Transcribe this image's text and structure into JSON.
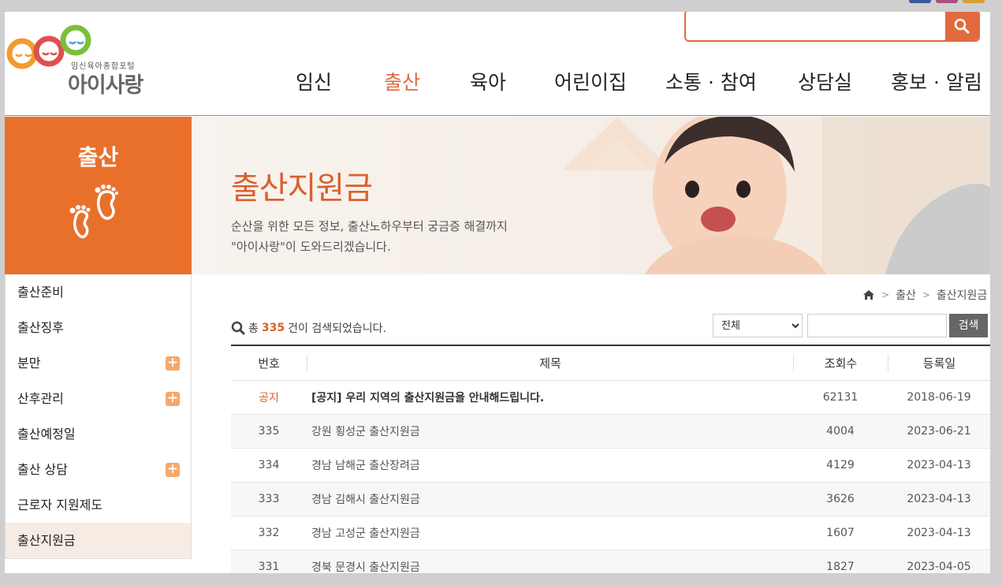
{
  "header": {
    "logo_sub": "임신육아종합포털",
    "logo_main": "아이사랑",
    "search_placeholder": "",
    "nav": [
      "임신",
      "출산",
      "육아",
      "어린이집",
      "소통 · 참여",
      "상담실",
      "홍보 · 알림"
    ],
    "active_nav": "출산"
  },
  "lnb": {
    "title": "출산",
    "items": [
      {
        "label": "출산준비",
        "expandable": false
      },
      {
        "label": "출산징후",
        "expandable": false
      },
      {
        "label": "분만",
        "expandable": true
      },
      {
        "label": "산후관리",
        "expandable": true
      },
      {
        "label": "출산예정일",
        "expandable": false
      },
      {
        "label": "출산 상담",
        "expandable": true
      },
      {
        "label": "근로자 지원제도",
        "expandable": false
      },
      {
        "label": "출산지원금",
        "expandable": false
      }
    ]
  },
  "banner": {
    "title": "출산지원금",
    "desc1": "순산을 위한 모든 정보, 출산노하우부터 궁금증 해결까지",
    "desc2": "\"아이사랑\"이 도와드리겠습니다."
  },
  "breadcrumb": [
    "출산",
    "출산지원금"
  ],
  "summary": {
    "prefix": "총",
    "count": "335",
    "suffix": "건이 검색되었습니다."
  },
  "filter": {
    "selected": "전체",
    "button": "검색"
  },
  "table": {
    "headers": {
      "no": "번호",
      "title": "제목",
      "views": "조회수",
      "date": "등록일"
    },
    "rows": [
      {
        "no": "공지",
        "title": "[공지] 우리 지역의 출산지원금을 안내해드립니다.",
        "views": "62131",
        "date": "2018-06-19",
        "notice": true
      },
      {
        "no": "335",
        "title": "강원 횡성군 출산지원금",
        "views": "4004",
        "date": "2023-06-21"
      },
      {
        "no": "334",
        "title": "경남 남해군 출산장려금",
        "views": "4129",
        "date": "2023-04-13"
      },
      {
        "no": "333",
        "title": "경남 김해시 출산지원금",
        "views": "3626",
        "date": "2023-04-13"
      },
      {
        "no": "332",
        "title": "경남 고성군 출산지원금",
        "views": "1607",
        "date": "2023-04-13"
      },
      {
        "no": "331",
        "title": "경북 문경시 출산지원금",
        "views": "1827",
        "date": "2023-04-05"
      }
    ]
  },
  "colors": {
    "accent": "#e26a3f",
    "lnb_bg": "#e8702b"
  }
}
